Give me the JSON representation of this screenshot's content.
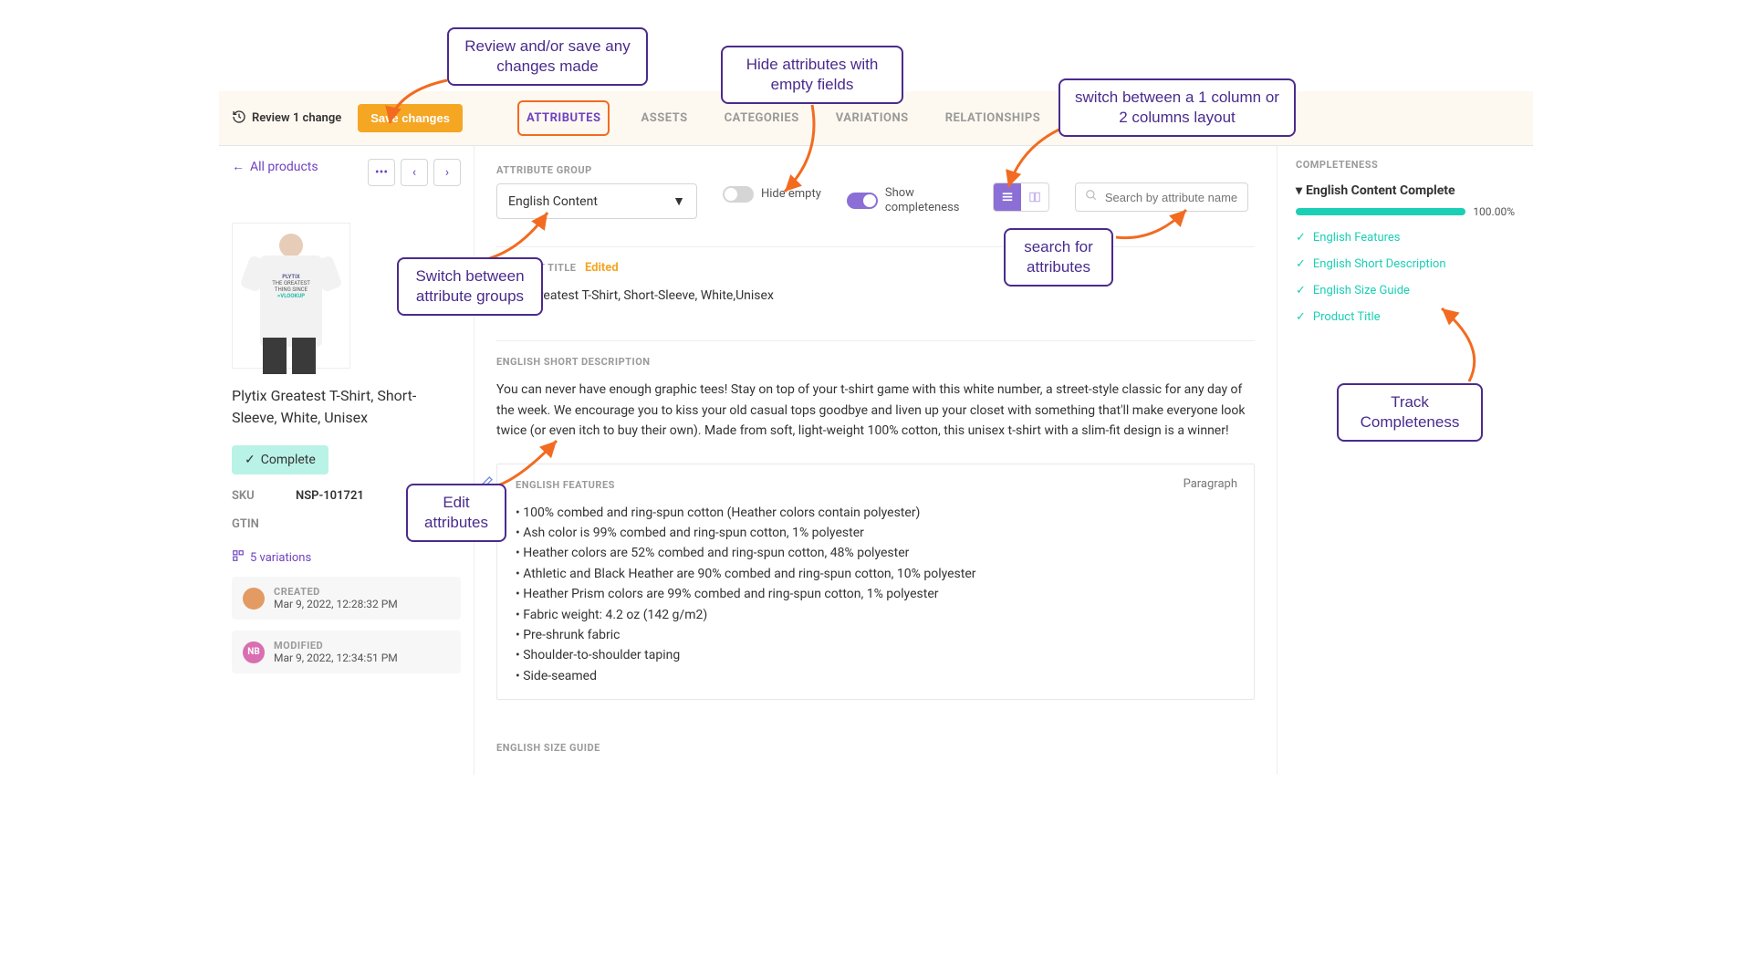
{
  "topbar": {
    "review_label": "Review 1 change",
    "save_label": "Save changes"
  },
  "tabs": {
    "attributes": "ATTRIBUTES",
    "assets": "ASSETS",
    "categories": "CATEGORIES",
    "variations": "VARIATIONS",
    "relationships": "RELATIONSHIPS"
  },
  "sidebar": {
    "all_products": "All products",
    "product_title": "Plytix Greatest T-Shirt, Short-Sleeve, White, Unisex",
    "complete_label": "Complete",
    "sku_label": "SKU",
    "sku_value": "NSP-101721",
    "gtin_label": "GTIN",
    "variations_link": "5 variations",
    "created_label": "CREATED",
    "created_value": "Mar 9, 2022, 12:28:32 PM",
    "modified_label": "MODIFIED",
    "modified_value": "Mar 9, 2022, 12:34:51 PM",
    "avatar2_text": "NB",
    "shirt_print_l1": "PLYTIX",
    "shirt_print_l2": "THE GREATEST THING SINCE",
    "shirt_print_l3": "=VLOOKUP"
  },
  "controls": {
    "attr_group_label": "ATTRIBUTE GROUP",
    "attr_group_value": "English Content",
    "hide_empty": "Hide empty",
    "show_completeness": "Show completeness",
    "search_placeholder": "Search by attribute name"
  },
  "attrs": {
    "product_title_label": "PRODUCT TITLE",
    "edited": "Edited",
    "product_title_value": "Plytix Greatest T-Shirt, Short-Sleeve, White,Unisex",
    "short_desc_label": "ENGLISH SHORT DESCRIPTION",
    "short_desc_value": "You can never have enough graphic tees! Stay on top of your t-shirt game with this white number, a street-style classic for any day of the week. We encourage you to kiss your old casual tops goodbye and liven up your closet with something that'll make everyone look twice (or even itch to buy their own). Made from soft, light-weight 100% cotton, this unisex t-shirt with a slim-fit design is a winner!",
    "features_label": "ENGLISH FEATURES",
    "features_type": "Paragraph",
    "features": [
      "100% combed and ring-spun cotton (Heather colors contain polyester)",
      "Ash color is 99% combed and ring-spun cotton, 1% polyester",
      "Heather colors are 52% combed and ring-spun cotton, 48% polyester",
      "Athletic and Black Heather are 90% combed and ring-spun cotton, 10% polyester",
      "Heather Prism colors are 99% combed and ring-spun cotton, 1% polyester",
      "Fabric weight: 4.2 oz (142 g/m2)",
      "Pre-shrunk fabric",
      "Shoulder-to-shoulder taping",
      "Side-seamed"
    ],
    "size_guide_label": "ENGLISH SIZE GUIDE"
  },
  "completeness": {
    "heading": "COMPLETENESS",
    "title": "English Content Complete",
    "percent": "100.00%",
    "items": [
      "English Features",
      "English Short Description",
      "English Size Guide",
      "Product Title"
    ]
  },
  "callouts": {
    "review": "Review and/or save any changes made",
    "hide": "Hide attributes with empty fields",
    "layout": "switch between a 1 column or 2 columns layout",
    "group": "Switch between attribute groups",
    "search": "search for attributes",
    "edit": "Edit attributes",
    "track": "Track Completeness"
  }
}
